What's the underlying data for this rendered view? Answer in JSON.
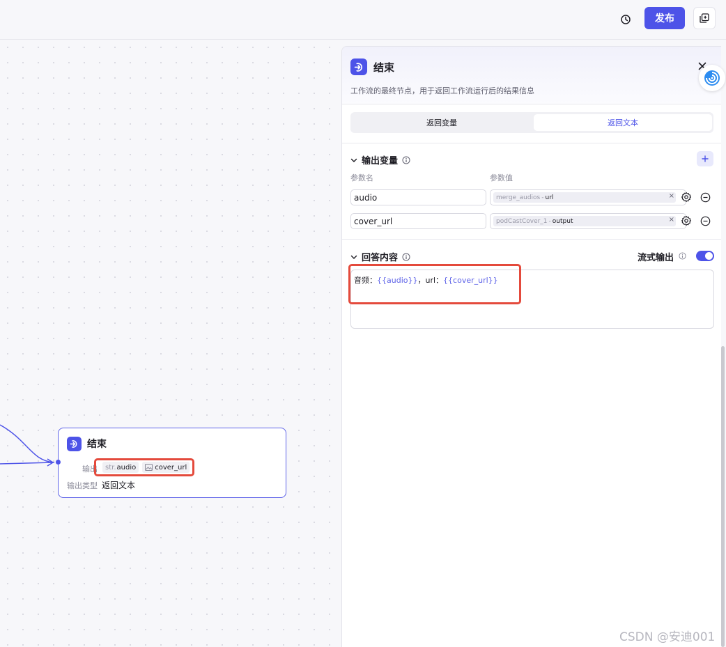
{
  "header": {
    "publish_label": "发布",
    "history_icon": "history-icon",
    "copy_icon": "copy-icon",
    "accent_color": "#4d53e8"
  },
  "canvas_node": {
    "title": "结束",
    "output_label": "输出",
    "outputs": [
      {
        "prefix": "str.",
        "name": "audio"
      },
      {
        "prefix": "",
        "icon": "image-icon",
        "name": "cover_url"
      }
    ],
    "output_type_label": "输出类型",
    "output_type_value": "返回文本"
  },
  "panel": {
    "title": "结束",
    "description": "工作流的最终节点，用于返回工作流运行后的结果信息",
    "tabs": [
      {
        "label": "返回变量",
        "active": false
      },
      {
        "label": "返回文本",
        "active": true
      }
    ],
    "output_section": {
      "title": "输出变量",
      "col_name": "参数名",
      "col_value": "参数值",
      "rows": [
        {
          "name": "audio",
          "ref_node": "merge_audios",
          "ref_sep": "-",
          "ref_field": "url"
        },
        {
          "name": "cover_url",
          "ref_node": "podCastCover_1",
          "ref_sep": "-",
          "ref_field": "output"
        }
      ]
    },
    "answer_section": {
      "title": "回答内容",
      "stream_label": "流式输出",
      "stream_enabled": true,
      "content_prefix": "音频：",
      "content_var1": "{{audio}}",
      "content_mid": "，url：",
      "content_var2": "{{cover_url}}"
    }
  },
  "watermark": "CSDN @安迪001"
}
